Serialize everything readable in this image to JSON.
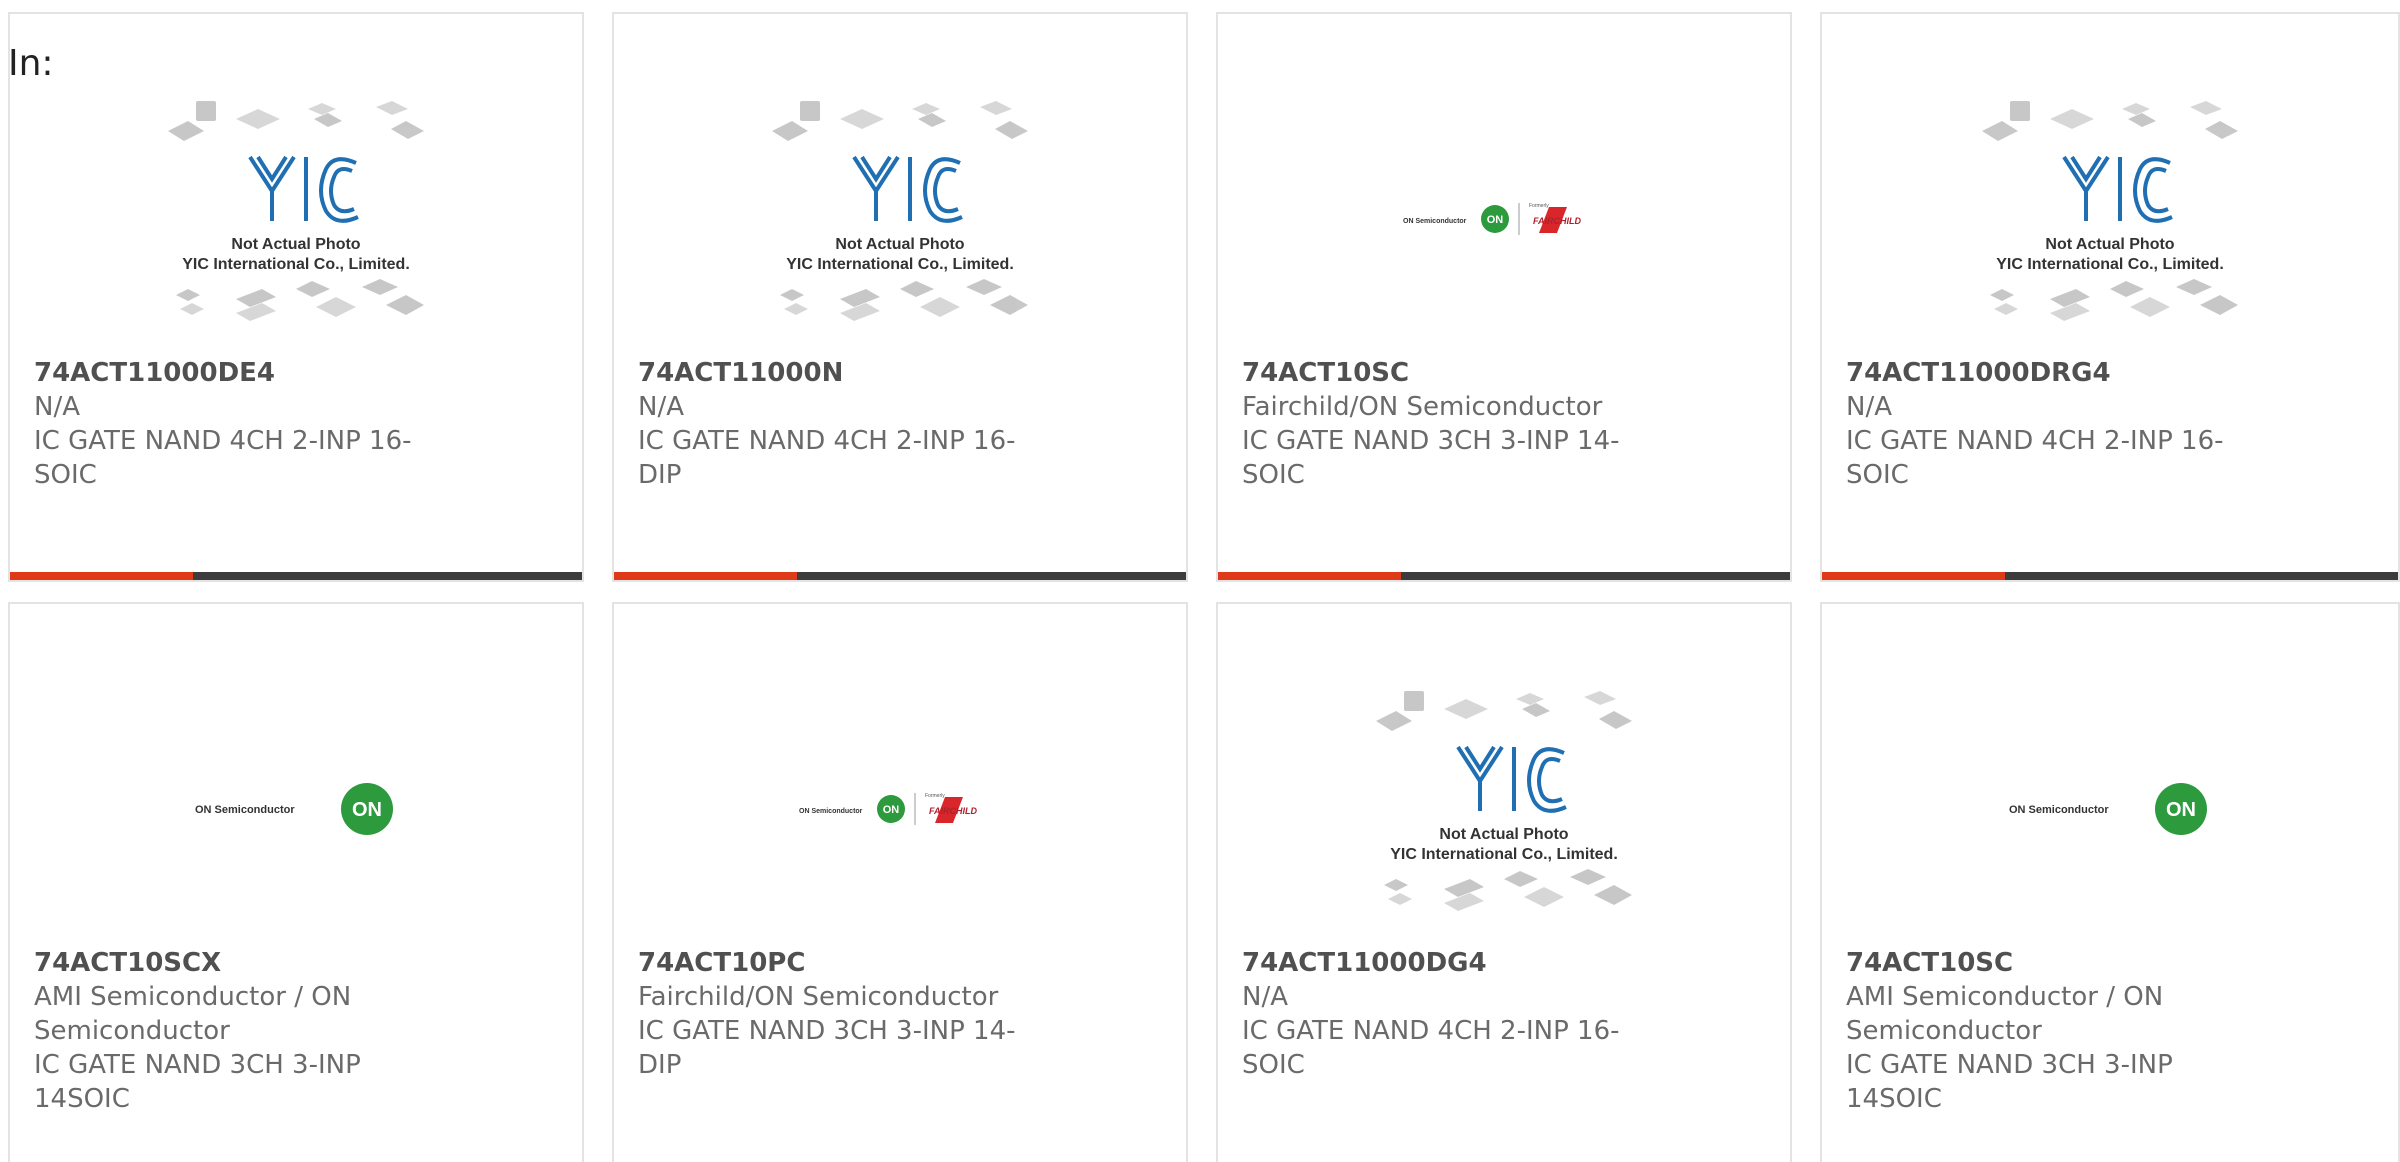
{
  "header": {
    "label": "In:"
  },
  "colors": {
    "accent": "#e0391a",
    "bar": "#3c3c3c",
    "on_green": "#2e9a3e",
    "yic_blue": "#1f6fb2",
    "fairchild_red": "#d8262b"
  },
  "placeholder_text": {
    "line1": "Not Actual Photo",
    "line2": "YIC International Co., Limited.",
    "logo": "YIC"
  },
  "on_logo_text": {
    "brand": "ON Semiconductor",
    "badge": "ON",
    "formerly": "Formerly",
    "fairchild": "FAIRCHILD"
  },
  "products": [
    {
      "part_number": "74ACT11000DE4",
      "manufacturer": "N/A",
      "description_line1": "IC GATE NAND 4CH 2-INP 16-",
      "description_line2": "SOIC",
      "image": "yic-placeholder"
    },
    {
      "part_number": "74ACT11000N",
      "manufacturer": "N/A",
      "description_line1": "IC GATE NAND 4CH 2-INP 16-DIP",
      "description_line2": "",
      "image": "yic-placeholder"
    },
    {
      "part_number": "74ACT10SC",
      "manufacturer": "Fairchild/ON Semiconductor",
      "description_line1": "IC GATE NAND 3CH 3-INP 14-",
      "description_line2": "SOIC",
      "image": "on-fairchild-logo"
    },
    {
      "part_number": "74ACT11000DRG4",
      "manufacturer": "N/A",
      "description_line1": "IC GATE NAND 4CH 2-INP 16-",
      "description_line2": "SOIC",
      "image": "yic-placeholder"
    },
    {
      "part_number": "74ACT10SCX",
      "manufacturer": "AMI Semiconductor / ON",
      "manufacturer_line2": "Semiconductor",
      "description_line1": "IC GATE NAND 3CH 3-INP",
      "description_line2": "14SOIC",
      "image": "on-logo"
    },
    {
      "part_number": "74ACT10PC",
      "manufacturer": "Fairchild/ON Semiconductor",
      "description_line1": "IC GATE NAND 3CH 3-INP 14-DIP",
      "description_line2": "",
      "image": "on-fairchild-logo"
    },
    {
      "part_number": "74ACT11000DG4",
      "manufacturer": "N/A",
      "description_line1": "IC GATE NAND 4CH 2-INP 16-",
      "description_line2": "SOIC",
      "image": "yic-placeholder"
    },
    {
      "part_number": "74ACT10SC",
      "manufacturer": "AMI Semiconductor / ON",
      "manufacturer_line2": "Semiconductor",
      "description_line1": "IC GATE NAND 3CH 3-INP",
      "description_line2": "14SOIC",
      "image": "on-logo"
    }
  ]
}
